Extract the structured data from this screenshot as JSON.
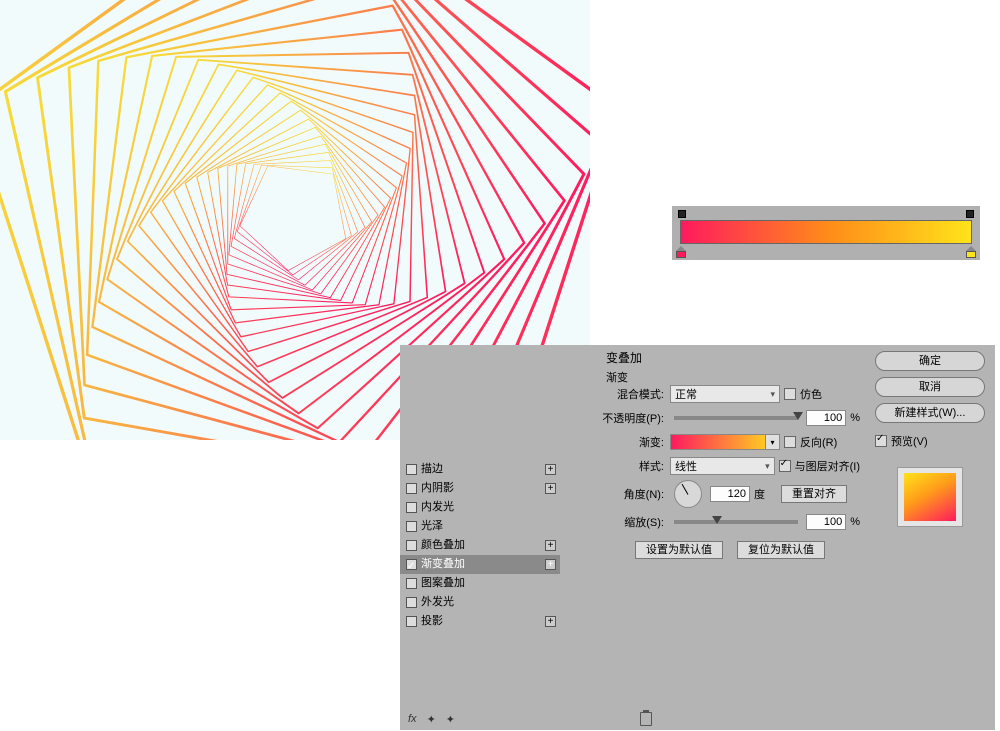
{
  "gradient_bar": {
    "stops": [
      {
        "pos": 0,
        "color": "#ff1a5e"
      },
      {
        "pos": 100,
        "color": "#ffe31a"
      }
    ]
  },
  "dialog": {
    "section_title": "变叠加",
    "section_sub": "渐变",
    "effects": [
      {
        "label": "描边",
        "checked": false,
        "add": true
      },
      {
        "label": "内阴影",
        "checked": false,
        "add": true
      },
      {
        "label": "内发光",
        "checked": false
      },
      {
        "label": "光泽",
        "checked": false
      },
      {
        "label": "颜色叠加",
        "checked": false,
        "add": true
      },
      {
        "label": "渐变叠加",
        "checked": true,
        "add": true,
        "selected": true
      },
      {
        "label": "图案叠加",
        "checked": false
      },
      {
        "label": "外发光",
        "checked": false
      },
      {
        "label": "投影",
        "checked": false,
        "add": true
      }
    ],
    "footer_fx": "fx",
    "form": {
      "blend_label": "混合模式:",
      "blend_value": "正常",
      "dither_label": "仿色",
      "opacity_label": "不透明度(P):",
      "opacity_value": "100",
      "opacity_suffix": "%",
      "grad_label": "渐变:",
      "reverse_label": "反向(R)",
      "style_label": "样式:",
      "style_value": "线性",
      "align_label": "与图层对齐(I)",
      "align_checked": true,
      "angle_label": "角度(N):",
      "angle_value": "120",
      "angle_suffix": "度",
      "reset_align": "重置对齐",
      "scale_label": "缩放(S):",
      "scale_value": "100",
      "scale_suffix": "%",
      "set_default": "设置为默认值",
      "reset_default": "复位为默认值"
    },
    "right": {
      "ok": "确定",
      "cancel": "取消",
      "new_style": "新建样式(W)...",
      "preview_label": "预览(V)",
      "preview_checked": true
    }
  }
}
